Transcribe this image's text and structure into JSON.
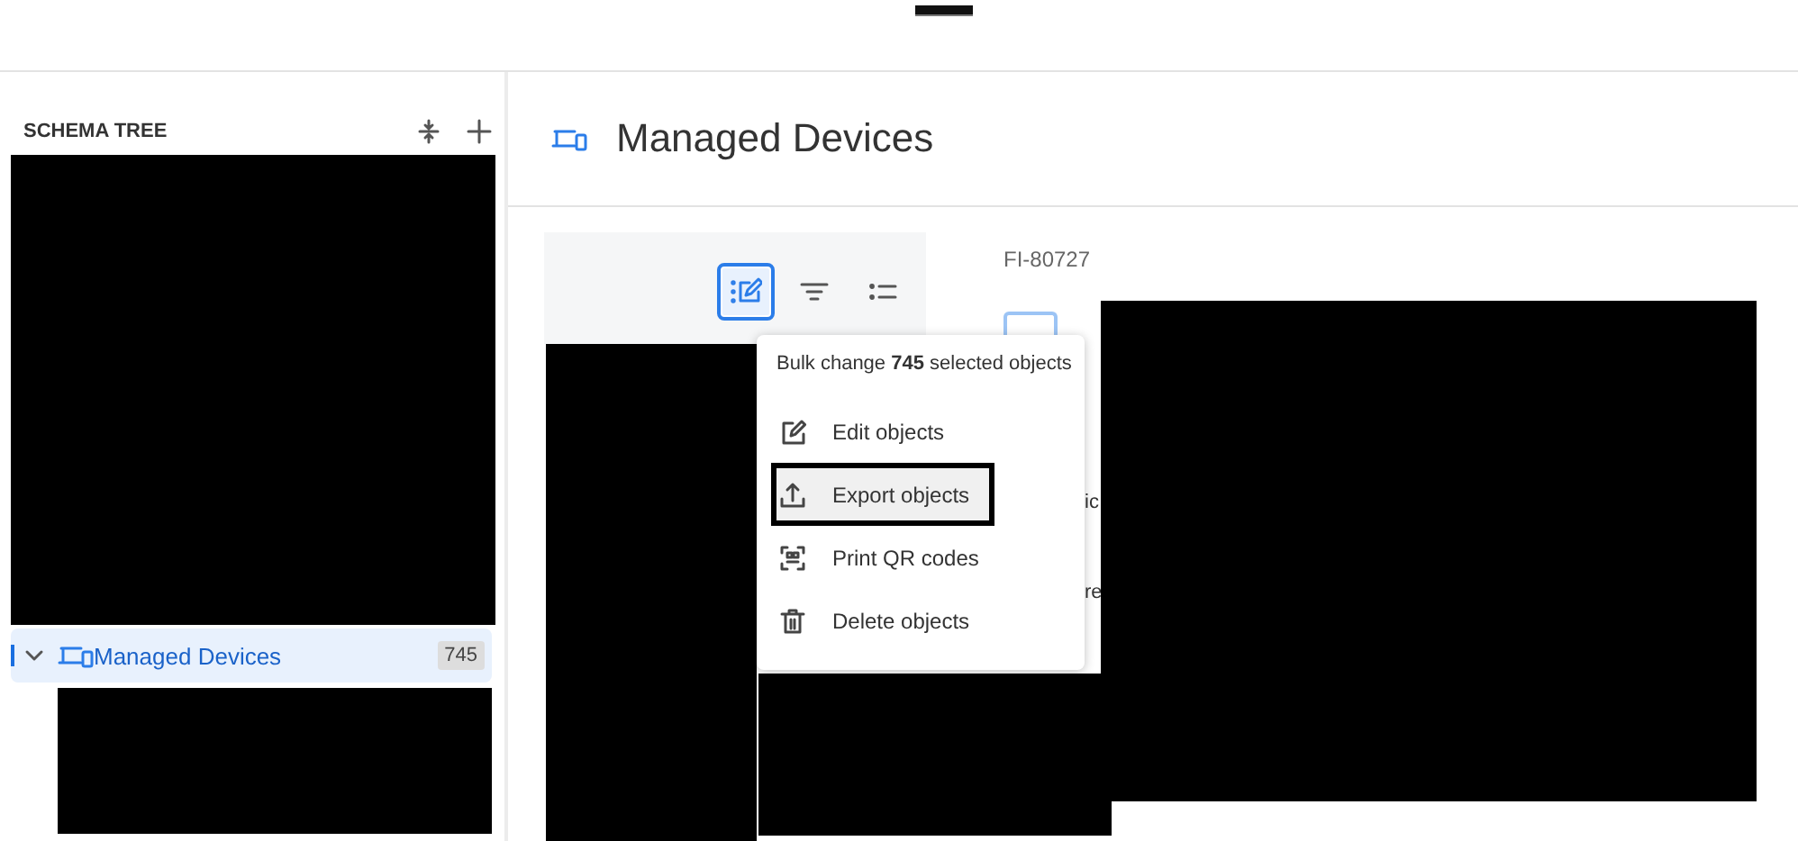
{
  "sidebar": {
    "title": "SCHEMA TREE",
    "tree": [
      {
        "label": "Managed Devices",
        "count": "745",
        "expanded": true,
        "selected": true
      }
    ]
  },
  "main": {
    "title": "Managed Devices",
    "toolbar": [
      {
        "kind": "bulk-edit",
        "selected": true
      },
      {
        "kind": "filter",
        "selected": false
      },
      {
        "kind": "list",
        "selected": false
      }
    ],
    "record_id": "FI-80727",
    "fragments": [
      "ic",
      "re"
    ],
    "menu": {
      "header": "Bulk change **745** selected objects",
      "items": [
        {
          "kind": "edit",
          "label": "Edit objects",
          "selected": false
        },
        {
          "kind": "export",
          "label": "Export objects",
          "selected": true
        },
        {
          "kind": "qr",
          "label": "Print QR codes",
          "selected": false
        },
        {
          "kind": "delete",
          "label": "Delete objects",
          "selected": false
        }
      ]
    }
  }
}
